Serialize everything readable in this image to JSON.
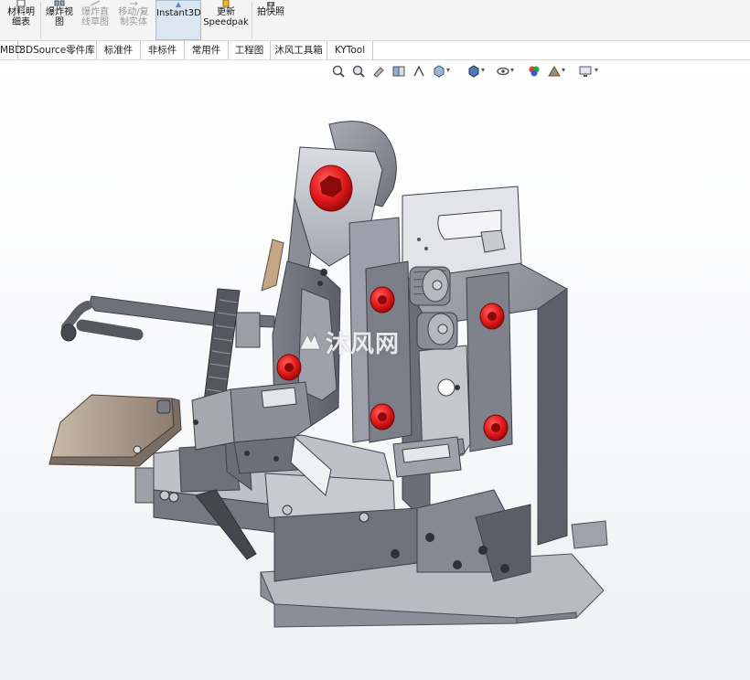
{
  "ribbon": {
    "items": [
      {
        "line1": "材料明",
        "line2": "细表",
        "state": "normal"
      },
      {
        "line1": "爆炸视",
        "line2": "图",
        "state": "normal"
      },
      {
        "line1": "爆炸直",
        "line2": "线草图",
        "state": "disabled"
      },
      {
        "line1": "移动/复",
        "line2": "制实体",
        "state": "disabled"
      },
      {
        "line1": "Instant3D",
        "line2": "",
        "state": "active"
      },
      {
        "line1": "更新",
        "line2": "Speedpak",
        "state": "normal"
      },
      {
        "line1": "拍快照",
        "line2": "",
        "state": "normal"
      }
    ]
  },
  "tabs": [
    "MBD",
    "3DSource零件库",
    "标准件",
    "非标件",
    "常用件",
    "工程图",
    "沐风工具箱",
    "KYTool"
  ],
  "view_toolbar": {
    "icons": [
      "zoom-to-fit-icon",
      "zoom-area-icon",
      "previous-view-icon",
      "section-view-icon",
      "dynamic-annotation-icon",
      "view-orientation-icon",
      "display-style-icon",
      "hide-show-icon",
      "edit-appearance-icon",
      "apply-scene-icon",
      "view-settings-icon"
    ]
  },
  "watermark": {
    "text": "沐风网"
  },
  "colors": {
    "accent_red": "#e01818",
    "metal": "#8a8c96",
    "background": "#ffffff"
  }
}
